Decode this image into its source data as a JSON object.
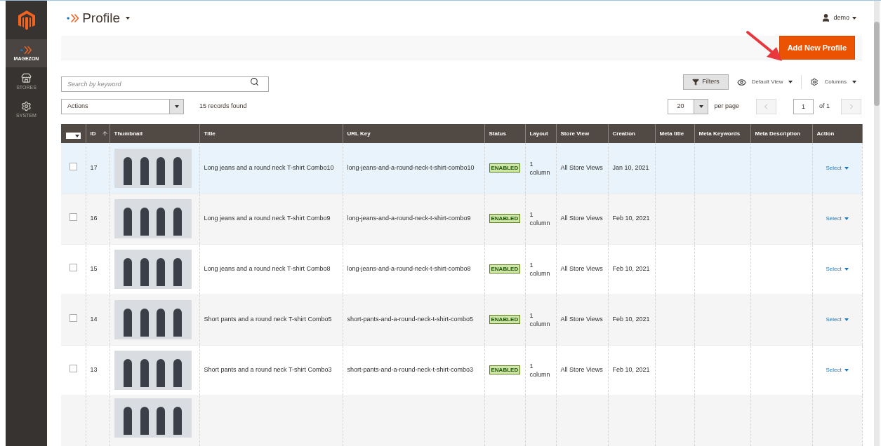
{
  "sidebar": {
    "items": [
      {
        "kind": "logo"
      },
      {
        "kind": "magezon",
        "label": "MAGEZON",
        "selected": true
      },
      {
        "kind": "stores",
        "label": "STORES",
        "selected": false
      },
      {
        "kind": "system",
        "label": "SYSTEM",
        "selected": false
      }
    ]
  },
  "header": {
    "title": "Profile",
    "user": "demo"
  },
  "page_actions": {
    "primary_button": "Add New Profile"
  },
  "toolbar": {
    "search": {
      "placeholder": "Search by keyword"
    },
    "filters": "Filters",
    "view": "Default View",
    "columns": "Columns",
    "actions": "Actions",
    "records": "15 records found",
    "per_page_value": "20",
    "per_page_label": "per page",
    "page": "1",
    "page_total": "of 1"
  },
  "table": {
    "columns": [
      "ID",
      "Thumbnail",
      "Title",
      "URL Key",
      "Status",
      "Layout",
      "Store View",
      "Creation",
      "Meta title",
      "Meta Keywords",
      "Meta Description",
      "Action"
    ],
    "rows": [
      {
        "checked": false,
        "highlighted": true,
        "id": "17",
        "title": "Long jeans and a round neck T-shirt Combo10",
        "url_key": "long-jeans-and-a-round-neck-t-shirt-combo10",
        "status": "ENABLED",
        "layout": "1 column",
        "store_view": "All Store Views",
        "creation": "Jan 10, 2021",
        "action": "Select"
      },
      {
        "checked": false,
        "highlighted": false,
        "id": "16",
        "title": "Long jeans and a round neck T-shirt Combo9",
        "url_key": "long-jeans-and-a-round-neck-t-shirt-combo9",
        "status": "ENABLED",
        "layout": "1 column",
        "store_view": "All Store Views",
        "creation": "Feb 10, 2021",
        "action": "Select"
      },
      {
        "checked": false,
        "highlighted": false,
        "id": "15",
        "title": "Long jeans and a round neck T-shirt Combo8",
        "url_key": "long-jeans-and-a-round-neck-t-shirt-combo8",
        "status": "ENABLED",
        "layout": "1 column",
        "store_view": "All Store Views",
        "creation": "Feb 10, 2021",
        "action": "Select"
      },
      {
        "checked": false,
        "highlighted": false,
        "id": "14",
        "title": "Short pants and a round neck T-shirt Combo5",
        "url_key": "short-pants-and-a-round-neck-t-shirt-combo5",
        "status": "ENABLED",
        "layout": "1 column",
        "store_view": "All Store Views",
        "creation": "Feb 10, 2021",
        "action": "Select"
      },
      {
        "checked": false,
        "highlighted": false,
        "id": "13",
        "title": "Short pants and a round neck T-shirt Combo3",
        "url_key": "short-pants-and-a-round-neck-t-shirt-combo3",
        "status": "ENABLED",
        "layout": "1 column",
        "store_view": "All Store Views",
        "creation": "Feb 10, 2021",
        "action": "Select"
      }
    ]
  }
}
